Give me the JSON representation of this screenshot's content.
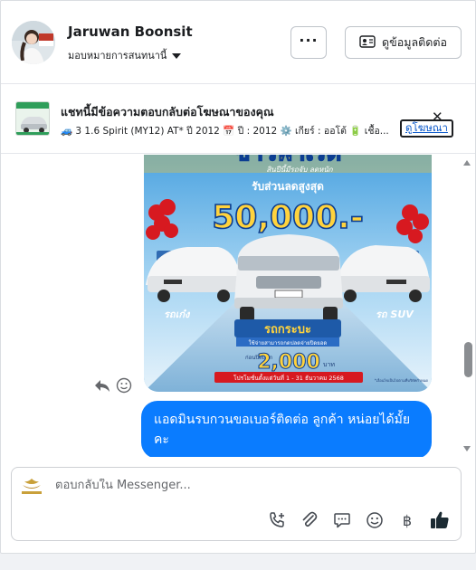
{
  "header": {
    "contact_name": "Jaruwan Boonsit",
    "assign_label": "มอบหมายการสนทนานี้",
    "more_label": "···",
    "contact_info_label": "ดูข้อมูลติดต่อ"
  },
  "ad_reply": {
    "title": "แชทนี้มีข้อความตอบกลับต่อโฆษณาของคุณ",
    "details": "🚙 3 1.6 Spirit (MY12) AT* ปี 2012 📅 ปี : 2012 ⚙️ เกียร์ : ออโต้ 🔋 เชื้อ...",
    "view_ad_label": "ดูโฆษณา",
    "close_label": "✕"
  },
  "thread": {
    "ad_image": {
      "headline": "ข่าวพาเรด",
      "tagline": "สินปีนี้มีรถจับ ลดหนัก",
      "discount_label": "รับส่วนลดสูงสุด",
      "discount_amount": "50,000.-",
      "left_tag": "รถเก๋ง",
      "right_tag": "รถ SUV",
      "center_label": "รถกระบะ",
      "center_sub": "ใช้จ่ายสามารถกดปลดจ่ายปิดยอด",
      "price_prefix": "ก่อนปิดแลก",
      "price_value": "2,000",
      "price_unit": "บาท",
      "promo_dates": "โปรโมชั่นตั้งแต่วันที่ 1 - 31 ธันวาคม 2568",
      "footer_note": "*เงื่อนไขเป็นไปตามที่บริษัทกำหนด"
    },
    "outgoing_message": "แอดมินรบกวนขอเบอร์ติดต่อ ลูกค้า หน่อยได้มั้ยคะ"
  },
  "composer": {
    "placeholder": "ตอบกลับใน Messenger..."
  },
  "colors": {
    "bubble": "#0a7cff",
    "link": "#0a58ca",
    "like": "#1c2b33"
  },
  "icons": [
    "more-icon",
    "contact-card-icon",
    "close-icon",
    "reply-icon",
    "emoji-react-icon",
    "call-add-icon",
    "attach-icon",
    "saved-reply-icon",
    "emoji-icon",
    "baht-icon",
    "thumbs-up-icon"
  ]
}
